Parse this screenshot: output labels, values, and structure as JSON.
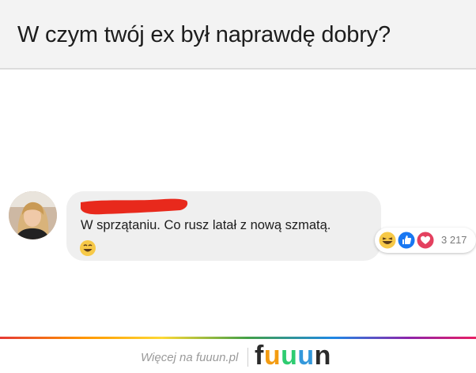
{
  "question": {
    "text": "W czym twój ex był naprawdę dobry?"
  },
  "comment": {
    "author_redacted": true,
    "text": "W sprzątaniu. Co rusz latał z nową szmatą.",
    "inline_emoji": "smiling-face-emoji"
  },
  "reactions": {
    "icons": [
      "laughing-reaction-icon",
      "like-reaction-icon",
      "love-reaction-icon"
    ],
    "count": "3 217"
  },
  "footer": {
    "more_text": "Więcej na fuuun.pl",
    "logo_letters": [
      "f",
      "u",
      "u",
      "u",
      "n"
    ],
    "logo_colors": [
      "#2b2b2b",
      "#f39c12",
      "#2ecc71",
      "#3498db",
      "#2b2b2b"
    ]
  },
  "colors": {
    "redaction": "#e8291c",
    "like": "#1877f2",
    "love": "#e4405f",
    "haha": "#f7c948"
  }
}
